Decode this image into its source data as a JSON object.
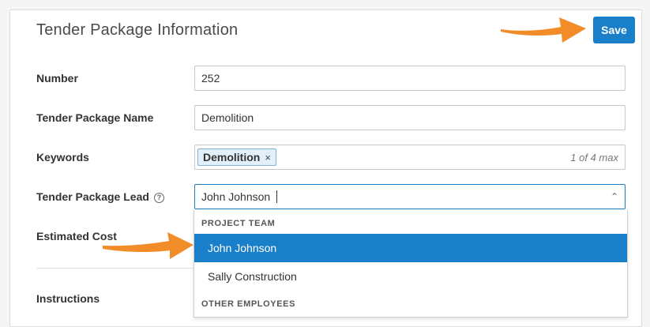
{
  "header": {
    "title": "Tender Package Information",
    "save_label": "Save"
  },
  "fields": {
    "number": {
      "label": "Number",
      "value": "252"
    },
    "name": {
      "label": "Tender Package Name",
      "value": "Demolition"
    },
    "keywords": {
      "label": "Keywords",
      "chip": "Demolition",
      "chip_remove": "×",
      "count": "1 of 4 max"
    },
    "lead": {
      "label": "Tender Package Lead",
      "value": "John Johnson",
      "help_glyph": "?",
      "chevron": "⌃"
    },
    "estimated_cost": {
      "label": "Estimated Cost"
    },
    "instructions": {
      "label": "Instructions"
    }
  },
  "dropdown": {
    "groups": [
      {
        "header": "PROJECT TEAM",
        "options": [
          "John Johnson",
          "Sally Construction"
        ]
      },
      {
        "header": "OTHER EMPLOYEES"
      }
    ]
  },
  "colors": {
    "accent": "#1a7fc9",
    "arrow": "#f28c28",
    "chip_bg": "#e3f0fa"
  },
  "icons": {
    "help": "help-circle-icon",
    "chevron": "chevron-up-icon",
    "remove": "close-icon"
  }
}
